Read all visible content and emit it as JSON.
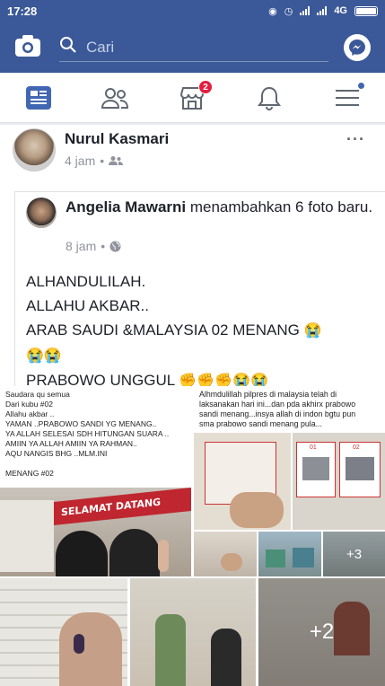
{
  "status": {
    "time": "17:28",
    "network": "4G"
  },
  "search": {
    "placeholder": "Cari"
  },
  "nav": {
    "marketplace_badge": "2"
  },
  "post": {
    "author": "Nurul Kasmari",
    "time": "4 jam",
    "more": "···",
    "shared": {
      "name": "Angelia Mawarni",
      "action": " menambahkan 6 foto baru.",
      "time": "8 jam",
      "lines": [
        "ALHANDULILAH.",
        "ALLAHU AKBAR..",
        "ARAB SAUDI &MALAYSIA 02 MENANG",
        "PRABOWO UNGGUL"
      ]
    },
    "photo1_caption": [
      "Saudara qu semua",
      "Dari kubu #02",
      "Allahu akbar ..",
      "YAMAN ..PRABOWO SANDI YG MENANG..",
      "YA ALLAH SELESAI SDH HITUNGAN SUARA ..",
      "AMIIN YA ALLAH AMIIN YA RAHMAN..",
      "AQU NANGIS BHG ..MLM.INI",
      "",
      "MENANG #02"
    ],
    "photo1_banner": "SELAMAT DATANG",
    "photo2_caption": [
      "Alhmdulillah pilpres di malaysia telah di",
      "laksanakan hari ini...dan pda akhirx prabowo",
      "sandi menang...insya allah di indon bgtu pun",
      "sma prabowo sandi menang pula..."
    ],
    "ballot_numbers": [
      "01",
      "02"
    ],
    "more_photos_a": "+3",
    "more_photos_b": "+2"
  },
  "colors": {
    "brand": "#3b5998",
    "badge": "#e41e3f"
  }
}
